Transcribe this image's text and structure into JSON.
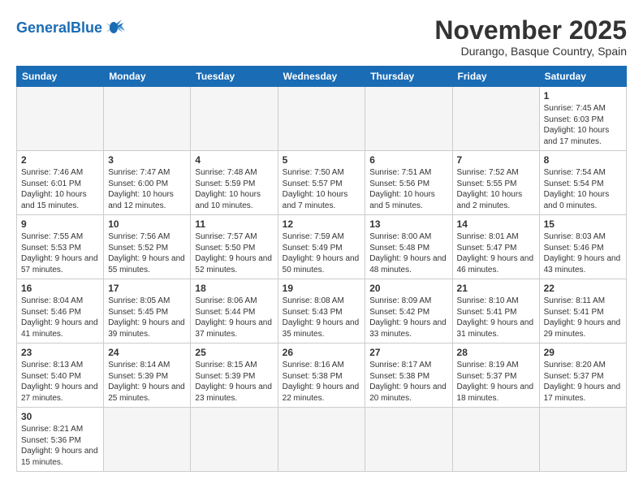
{
  "header": {
    "logo_general": "General",
    "logo_blue": "Blue",
    "month_title": "November 2025",
    "subtitle": "Durango, Basque Country, Spain"
  },
  "weekdays": [
    "Sunday",
    "Monday",
    "Tuesday",
    "Wednesday",
    "Thursday",
    "Friday",
    "Saturday"
  ],
  "weeks": [
    [
      {
        "day": "",
        "info": ""
      },
      {
        "day": "",
        "info": ""
      },
      {
        "day": "",
        "info": ""
      },
      {
        "day": "",
        "info": ""
      },
      {
        "day": "",
        "info": ""
      },
      {
        "day": "",
        "info": ""
      },
      {
        "day": "1",
        "info": "Sunrise: 7:45 AM\nSunset: 6:03 PM\nDaylight: 10 hours\nand 17 minutes."
      }
    ],
    [
      {
        "day": "2",
        "info": "Sunrise: 7:46 AM\nSunset: 6:01 PM\nDaylight: 10 hours\nand 15 minutes."
      },
      {
        "day": "3",
        "info": "Sunrise: 7:47 AM\nSunset: 6:00 PM\nDaylight: 10 hours\nand 12 minutes."
      },
      {
        "day": "4",
        "info": "Sunrise: 7:48 AM\nSunset: 5:59 PM\nDaylight: 10 hours\nand 10 minutes."
      },
      {
        "day": "5",
        "info": "Sunrise: 7:50 AM\nSunset: 5:57 PM\nDaylight: 10 hours\nand 7 minutes."
      },
      {
        "day": "6",
        "info": "Sunrise: 7:51 AM\nSunset: 5:56 PM\nDaylight: 10 hours\nand 5 minutes."
      },
      {
        "day": "7",
        "info": "Sunrise: 7:52 AM\nSunset: 5:55 PM\nDaylight: 10 hours\nand 2 minutes."
      },
      {
        "day": "8",
        "info": "Sunrise: 7:54 AM\nSunset: 5:54 PM\nDaylight: 10 hours\nand 0 minutes."
      }
    ],
    [
      {
        "day": "9",
        "info": "Sunrise: 7:55 AM\nSunset: 5:53 PM\nDaylight: 9 hours\nand 57 minutes."
      },
      {
        "day": "10",
        "info": "Sunrise: 7:56 AM\nSunset: 5:52 PM\nDaylight: 9 hours\nand 55 minutes."
      },
      {
        "day": "11",
        "info": "Sunrise: 7:57 AM\nSunset: 5:50 PM\nDaylight: 9 hours\nand 52 minutes."
      },
      {
        "day": "12",
        "info": "Sunrise: 7:59 AM\nSunset: 5:49 PM\nDaylight: 9 hours\nand 50 minutes."
      },
      {
        "day": "13",
        "info": "Sunrise: 8:00 AM\nSunset: 5:48 PM\nDaylight: 9 hours\nand 48 minutes."
      },
      {
        "day": "14",
        "info": "Sunrise: 8:01 AM\nSunset: 5:47 PM\nDaylight: 9 hours\nand 46 minutes."
      },
      {
        "day": "15",
        "info": "Sunrise: 8:03 AM\nSunset: 5:46 PM\nDaylight: 9 hours\nand 43 minutes."
      }
    ],
    [
      {
        "day": "16",
        "info": "Sunrise: 8:04 AM\nSunset: 5:46 PM\nDaylight: 9 hours\nand 41 minutes."
      },
      {
        "day": "17",
        "info": "Sunrise: 8:05 AM\nSunset: 5:45 PM\nDaylight: 9 hours\nand 39 minutes."
      },
      {
        "day": "18",
        "info": "Sunrise: 8:06 AM\nSunset: 5:44 PM\nDaylight: 9 hours\nand 37 minutes."
      },
      {
        "day": "19",
        "info": "Sunrise: 8:08 AM\nSunset: 5:43 PM\nDaylight: 9 hours\nand 35 minutes."
      },
      {
        "day": "20",
        "info": "Sunrise: 8:09 AM\nSunset: 5:42 PM\nDaylight: 9 hours\nand 33 minutes."
      },
      {
        "day": "21",
        "info": "Sunrise: 8:10 AM\nSunset: 5:41 PM\nDaylight: 9 hours\nand 31 minutes."
      },
      {
        "day": "22",
        "info": "Sunrise: 8:11 AM\nSunset: 5:41 PM\nDaylight: 9 hours\nand 29 minutes."
      }
    ],
    [
      {
        "day": "23",
        "info": "Sunrise: 8:13 AM\nSunset: 5:40 PM\nDaylight: 9 hours\nand 27 minutes."
      },
      {
        "day": "24",
        "info": "Sunrise: 8:14 AM\nSunset: 5:39 PM\nDaylight: 9 hours\nand 25 minutes."
      },
      {
        "day": "25",
        "info": "Sunrise: 8:15 AM\nSunset: 5:39 PM\nDaylight: 9 hours\nand 23 minutes."
      },
      {
        "day": "26",
        "info": "Sunrise: 8:16 AM\nSunset: 5:38 PM\nDaylight: 9 hours\nand 22 minutes."
      },
      {
        "day": "27",
        "info": "Sunrise: 8:17 AM\nSunset: 5:38 PM\nDaylight: 9 hours\nand 20 minutes."
      },
      {
        "day": "28",
        "info": "Sunrise: 8:19 AM\nSunset: 5:37 PM\nDaylight: 9 hours\nand 18 minutes."
      },
      {
        "day": "29",
        "info": "Sunrise: 8:20 AM\nSunset: 5:37 PM\nDaylight: 9 hours\nand 17 minutes."
      }
    ],
    [
      {
        "day": "30",
        "info": "Sunrise: 8:21 AM\nSunset: 5:36 PM\nDaylight: 9 hours\nand 15 minutes."
      },
      {
        "day": "",
        "info": ""
      },
      {
        "day": "",
        "info": ""
      },
      {
        "day": "",
        "info": ""
      },
      {
        "day": "",
        "info": ""
      },
      {
        "day": "",
        "info": ""
      },
      {
        "day": "",
        "info": ""
      }
    ]
  ]
}
